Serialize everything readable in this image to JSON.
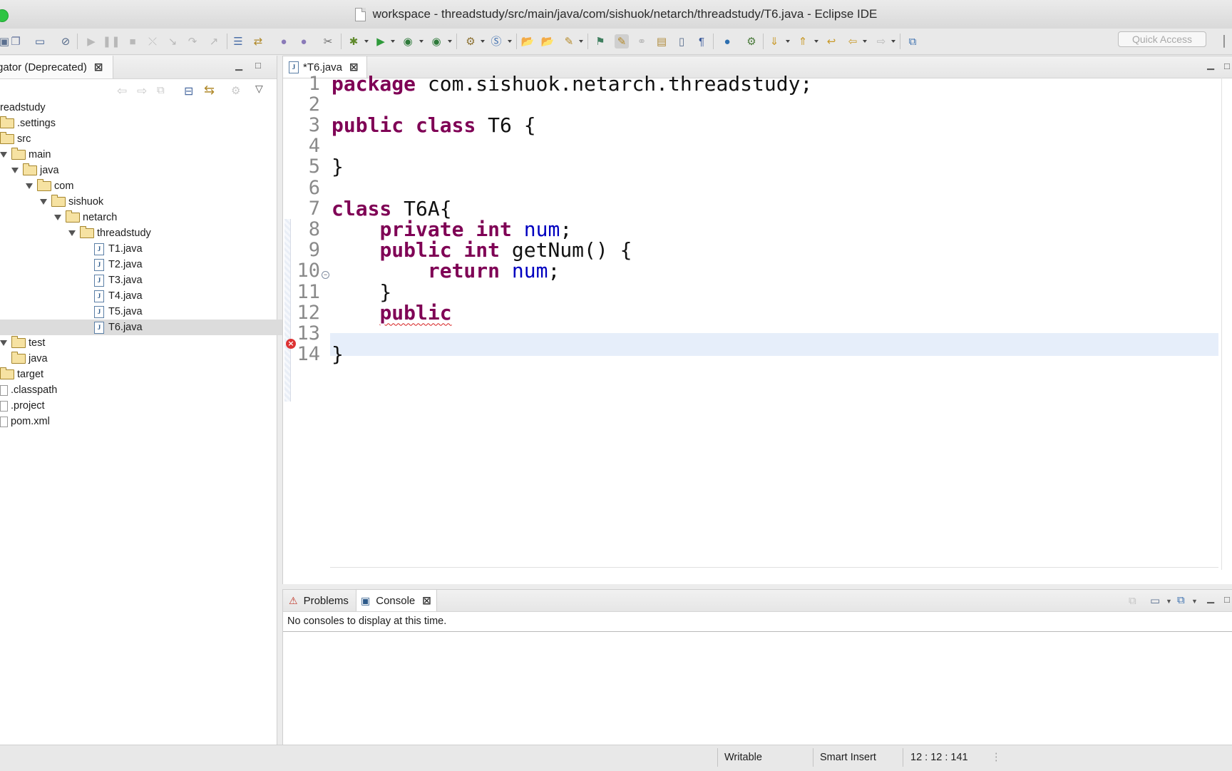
{
  "window": {
    "title": "workspace - threadstudy/src/main/java/com/sishuok/netarch/threadstudy/T6.java - Eclipse IDE"
  },
  "toolbar": {
    "quick_access_placeholder": "Quick Access"
  },
  "navigator": {
    "tab_label": "gator (Deprecated)",
    "tree": [
      {
        "label": "readstudy",
        "type": "project",
        "depth": 0
      },
      {
        "label": ".settings",
        "type": "folder",
        "depth": 0
      },
      {
        "label": "src",
        "type": "folder",
        "depth": 0
      },
      {
        "label": "main",
        "type": "folder",
        "depth": 0,
        "expanded": true
      },
      {
        "label": "java",
        "type": "folder",
        "depth": 1,
        "expanded": true
      },
      {
        "label": "com",
        "type": "folder",
        "depth": 2,
        "expanded": true
      },
      {
        "label": "sishuok",
        "type": "folder",
        "depth": 3,
        "expanded": true
      },
      {
        "label": "netarch",
        "type": "folder",
        "depth": 4,
        "expanded": true
      },
      {
        "label": "threadstudy",
        "type": "folder",
        "depth": 5,
        "expanded": true
      },
      {
        "label": "T1.java",
        "type": "java",
        "depth": 6
      },
      {
        "label": "T2.java",
        "type": "java",
        "depth": 6
      },
      {
        "label": "T3.java",
        "type": "java",
        "depth": 6
      },
      {
        "label": "T4.java",
        "type": "java",
        "depth": 6
      },
      {
        "label": "T5.java",
        "type": "java",
        "depth": 6
      },
      {
        "label": "T6.java",
        "type": "java",
        "depth": 6,
        "selected": true
      },
      {
        "label": "test",
        "type": "folder",
        "depth": 0,
        "expanded": true
      },
      {
        "label": "java",
        "type": "folder",
        "depth": 1
      },
      {
        "label": "target",
        "type": "folder",
        "depth": 0
      },
      {
        "label": ".classpath",
        "type": "file",
        "depth": 0
      },
      {
        "label": ".project",
        "type": "file",
        "depth": 0
      },
      {
        "label": "pom.xml",
        "type": "file",
        "depth": 0
      }
    ]
  },
  "editor": {
    "tab_label": "*T6.java",
    "lines": [
      {
        "n": "1",
        "tokens": [
          {
            "t": "package",
            "c": "kw"
          },
          {
            "t": " com.sishuok.netarch.threadstudy;",
            "c": "plain"
          }
        ]
      },
      {
        "n": "2",
        "tokens": []
      },
      {
        "n": "3",
        "tokens": [
          {
            "t": "public",
            "c": "kw"
          },
          {
            "t": " ",
            "c": "plain"
          },
          {
            "t": "class",
            "c": "kw"
          },
          {
            "t": " T6 {",
            "c": "plain"
          }
        ]
      },
      {
        "n": "4",
        "tokens": []
      },
      {
        "n": "5",
        "tokens": [
          {
            "t": "}",
            "c": "plain"
          }
        ]
      },
      {
        "n": "6",
        "tokens": []
      },
      {
        "n": "7",
        "tokens": [
          {
            "t": "class",
            "c": "kw"
          },
          {
            "t": " T6A{",
            "c": "plain"
          }
        ]
      },
      {
        "n": "8",
        "tokens": [
          {
            "t": "    ",
            "c": "plain"
          },
          {
            "t": "private",
            "c": "kw"
          },
          {
            "t": " ",
            "c": "plain"
          },
          {
            "t": "int",
            "c": "kw"
          },
          {
            "t": " ",
            "c": "plain"
          },
          {
            "t": "num",
            "c": "fld"
          },
          {
            "t": ";",
            "c": "plain"
          }
        ]
      },
      {
        "n": "9",
        "tokens": [
          {
            "t": "    ",
            "c": "plain"
          },
          {
            "t": "public",
            "c": "kw"
          },
          {
            "t": " ",
            "c": "plain"
          },
          {
            "t": "int",
            "c": "kw"
          },
          {
            "t": " getNum() {",
            "c": "plain"
          }
        ]
      },
      {
        "n": "10",
        "tokens": [
          {
            "t": "        ",
            "c": "plain"
          },
          {
            "t": "return",
            "c": "kw"
          },
          {
            "t": " ",
            "c": "plain"
          },
          {
            "t": "num",
            "c": "fld"
          },
          {
            "t": ";",
            "c": "plain"
          }
        ]
      },
      {
        "n": "11",
        "tokens": [
          {
            "t": "    }",
            "c": "plain"
          }
        ]
      },
      {
        "n": "12",
        "tokens": [
          {
            "t": "    ",
            "c": "plain"
          },
          {
            "t": "public",
            "c": "kw err"
          }
        ],
        "error": true,
        "current": true
      },
      {
        "n": "13",
        "tokens": []
      },
      {
        "n": "14",
        "tokens": [
          {
            "t": "}",
            "c": "plain"
          }
        ]
      }
    ]
  },
  "console": {
    "tabs": [
      {
        "label": "Problems",
        "icon": "problems-icon",
        "active": false
      },
      {
        "label": "Console",
        "icon": "console-icon",
        "active": true
      }
    ],
    "message": "No consoles to display at this time."
  },
  "status": {
    "writable": "Writable",
    "insert_mode": "Smart Insert",
    "position": "12 : 12 : 141"
  },
  "colors": {
    "keyword": "#7f0055",
    "field": "#0000c0",
    "current_line": "#e6eefa",
    "error": "#d33333"
  }
}
